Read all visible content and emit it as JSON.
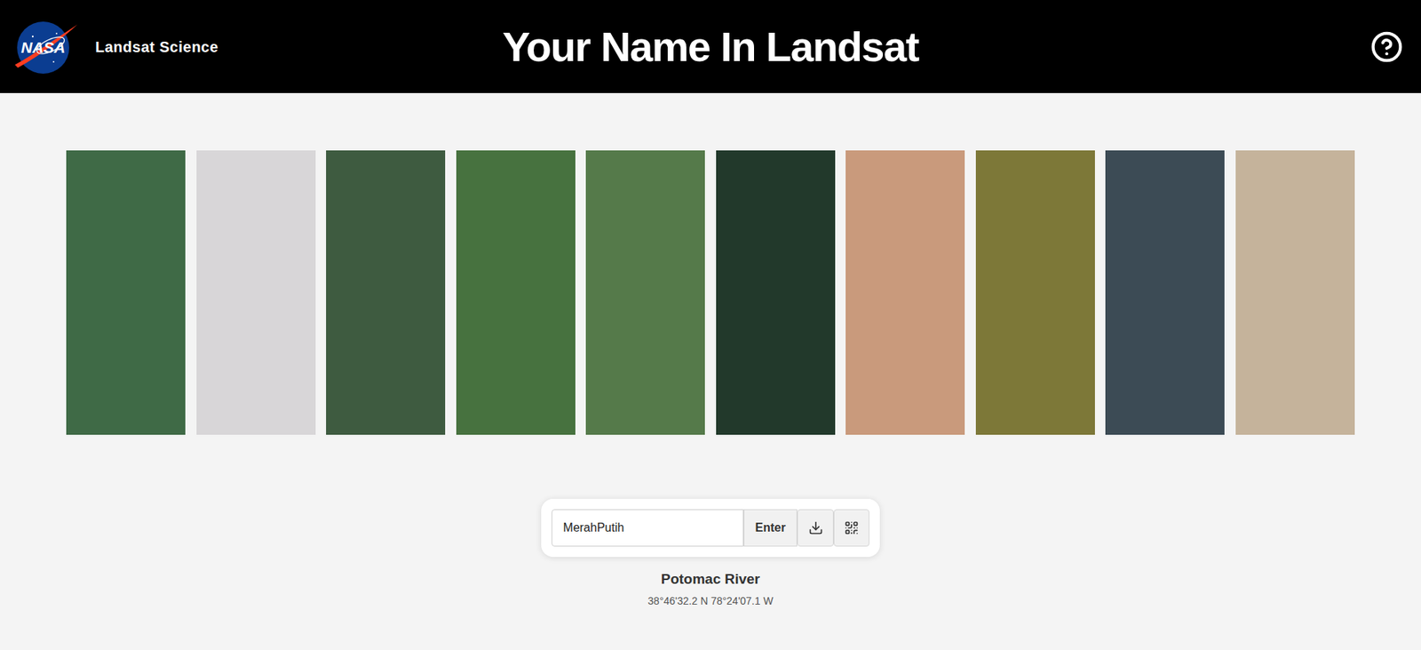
{
  "header": {
    "logo_text": "NASA",
    "site": "Landsat Science",
    "title": "Your Name In Landsat"
  },
  "tiles": [
    {
      "color": "#3f6a46"
    },
    {
      "color": "#d8d6d8"
    },
    {
      "color": "#3e5b40"
    },
    {
      "color": "#47723f"
    },
    {
      "color": "#557a4a"
    },
    {
      "color": "#22392b"
    },
    {
      "color": "#c99a7c"
    },
    {
      "color": "#7d7838"
    },
    {
      "color": "#3c4b55"
    },
    {
      "color": "#c5b39b"
    }
  ],
  "search": {
    "value": "MerahPutih",
    "buttons": [
      "Enter"
    ]
  },
  "location": {
    "name": "Potomac River",
    "coordinates": "38°46'32.2 N 78°24'07.1 W"
  }
}
